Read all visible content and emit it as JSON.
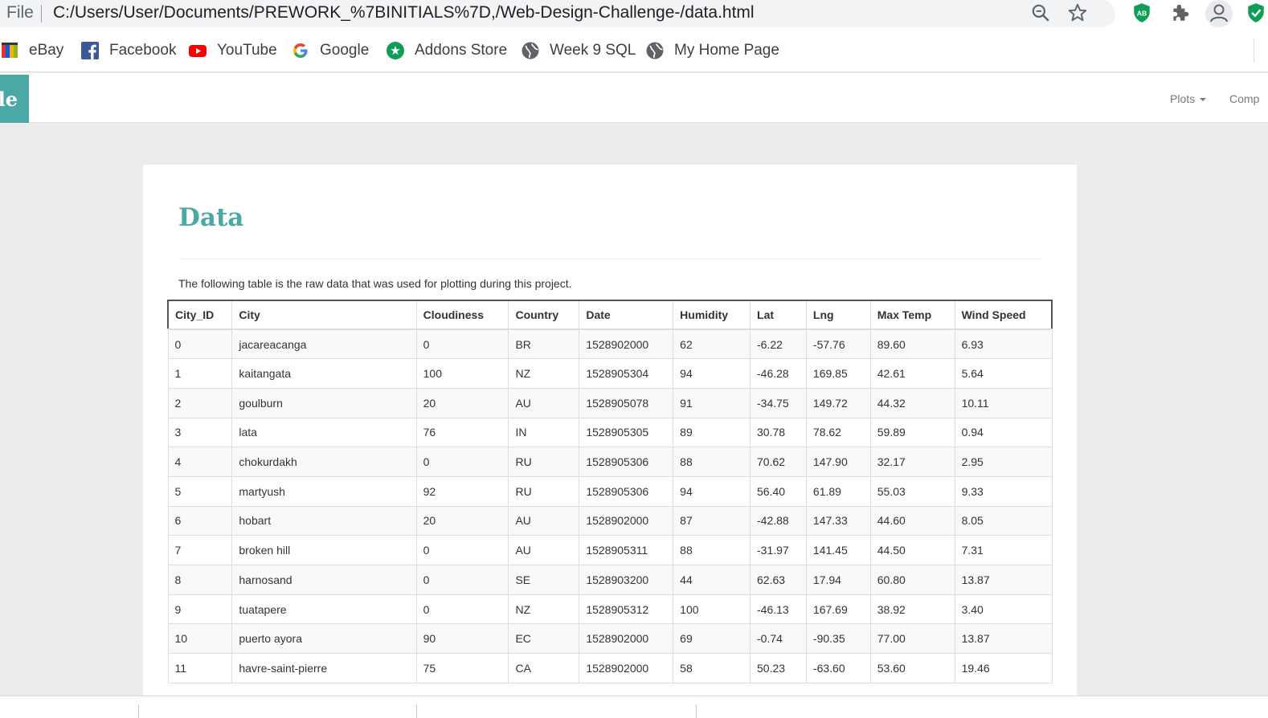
{
  "browser": {
    "file_label": "File",
    "url": "C:/Users/User/Documents/PREWORK_%7BINITIALS%7D,/Web-Design-Challenge-/data.html",
    "extensions": [
      {
        "name": "adblock",
        "label": "AB",
        "color": "#0f9d58"
      },
      {
        "name": "puzzle",
        "color": "#5f6368"
      },
      {
        "name": "profile",
        "color": "#5f6368"
      },
      {
        "name": "shield",
        "color": "#0f9d58"
      }
    ]
  },
  "bookmarks": [
    {
      "label": "eBay",
      "icon": "ebay-icon"
    },
    {
      "label": "Facebook",
      "icon": "facebook-icon"
    },
    {
      "label": "YouTube",
      "icon": "youtube-icon"
    },
    {
      "label": "Google",
      "icon": "google-icon"
    },
    {
      "label": "Addons Store",
      "icon": "addons-icon"
    },
    {
      "label": "Week 9 SQL",
      "icon": "globe-icon"
    },
    {
      "label": "My Home Page",
      "icon": "globe-icon"
    }
  ],
  "site_nav": {
    "brand_fragment": "le",
    "plots_label": "Plots",
    "comp_label": "Comp",
    "accent": "#4aa9a4"
  },
  "main": {
    "title": "Data",
    "intro": "The following table is the raw data that was used for plotting during this project."
  },
  "table": {
    "headers": [
      "City_ID",
      "City",
      "Cloudiness",
      "Country",
      "Date",
      "Humidity",
      "Lat",
      "Lng",
      "Max Temp",
      "Wind Speed"
    ],
    "rows": [
      [
        "0",
        "jacareacanga",
        "0",
        "BR",
        "1528902000",
        "62",
        "-6.22",
        "-57.76",
        "89.60",
        "6.93"
      ],
      [
        "1",
        "kaitangata",
        "100",
        "NZ",
        "1528905304",
        "94",
        "-46.28",
        "169.85",
        "42.61",
        "5.64"
      ],
      [
        "2",
        "goulburn",
        "20",
        "AU",
        "1528905078",
        "91",
        "-34.75",
        "149.72",
        "44.32",
        "10.11"
      ],
      [
        "3",
        "lata",
        "76",
        "IN",
        "1528905305",
        "89",
        "30.78",
        "78.62",
        "59.89",
        "0.94"
      ],
      [
        "4",
        "chokurdakh",
        "0",
        "RU",
        "1528905306",
        "88",
        "70.62",
        "147.90",
        "32.17",
        "2.95"
      ],
      [
        "5",
        "martyush",
        "92",
        "RU",
        "1528905306",
        "94",
        "56.40",
        "61.89",
        "55.03",
        "9.33"
      ],
      [
        "6",
        "hobart",
        "20",
        "AU",
        "1528902000",
        "87",
        "-42.88",
        "147.33",
        "44.60",
        "8.05"
      ],
      [
        "7",
        "broken hill",
        "0",
        "AU",
        "1528905311",
        "88",
        "-31.97",
        "141.45",
        "44.50",
        "7.31"
      ],
      [
        "8",
        "harnosand",
        "0",
        "SE",
        "1528903200",
        "44",
        "62.63",
        "17.94",
        "60.80",
        "13.87"
      ],
      [
        "9",
        "tuatapere",
        "0",
        "NZ",
        "1528905312",
        "100",
        "-46.13",
        "167.69",
        "38.92",
        "3.40"
      ],
      [
        "10",
        "puerto ayora",
        "90",
        "EC",
        "1528902000",
        "69",
        "-0.74",
        "-90.35",
        "77.00",
        "13.87"
      ],
      [
        "11",
        "havre-saint-pierre",
        "75",
        "CA",
        "1528902000",
        "58",
        "50.23",
        "-63.60",
        "53.60",
        "19.46"
      ]
    ]
  }
}
